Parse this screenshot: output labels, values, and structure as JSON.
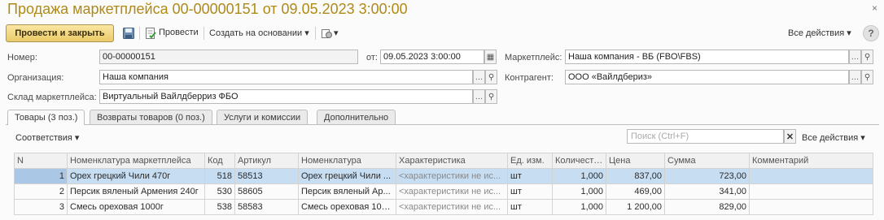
{
  "window": {
    "title": "Продажа маркетплейса 00-00000151 от 09.05.2023 3:00:00"
  },
  "toolbar": {
    "post_close_label": "Провести и закрыть",
    "post_label": "Провести",
    "create_based_label": "Создать на основании",
    "all_actions_label": "Все действия",
    "help_label": "?"
  },
  "form": {
    "number_label": "Номер:",
    "number_value": "00-00000151",
    "date_label": "от:",
    "date_value": "09.05.2023  3:00:00",
    "marketplace_label": "Маркетплейс:",
    "marketplace_value": "Наша компания - ВБ (FBO\\FBS)",
    "organization_label": "Организация:",
    "organization_value": "Наша компания",
    "counterparty_label": "Контрагент:",
    "counterparty_value": "ООО «Вайлдбериз»",
    "warehouse_label": "Склад маркетплейса:",
    "warehouse_value": "Виртуальный Вайлдберриз ФБО"
  },
  "tabs": [
    {
      "label": "Товары (3 поз.)"
    },
    {
      "label": "Возвраты товаров (0 поз.)"
    },
    {
      "label": "Услуги и комиссии"
    },
    {
      "label": "Дополнительно"
    }
  ],
  "table_toolbar": {
    "correspondences_label": "Соответствия",
    "search_placeholder": "Поиск (Ctrl+F)",
    "all_actions_label": "Все действия"
  },
  "table": {
    "columns": [
      "N",
      "Номенклатура маркетплейса",
      "Код",
      "Артикул",
      "Номенклатура",
      "Характеристика",
      "Ед. изм.",
      "Количество",
      "Цена",
      "Сумма",
      "Комментарий"
    ],
    "rows": [
      {
        "n": "1",
        "mp_item": "Орех грецкий Чили 470г",
        "code": "518",
        "article": "58513",
        "item": "Орех грецкий Чили ...",
        "characteristic": "<характеристики не ис...",
        "unit": "шт",
        "qty": "1,000",
        "price": "837,00",
        "sum": "723,00",
        "comment": ""
      },
      {
        "n": "2",
        "mp_item": "Персик вяленый Армения 240г",
        "code": "530",
        "article": "58605",
        "item": "Персик вяленый Ар...",
        "characteristic": "<характеристики не ис...",
        "unit": "шт",
        "qty": "1,000",
        "price": "469,00",
        "sum": "341,00",
        "comment": ""
      },
      {
        "n": "3",
        "mp_item": "Смесь ореховая 1000г",
        "code": "538",
        "article": "58583",
        "item": "Смесь ореховая 100...",
        "characteristic": "<характеристики не ис...",
        "unit": "шт",
        "qty": "1,000",
        "price": "1 200,00",
        "sum": "829,00",
        "comment": ""
      }
    ]
  }
}
